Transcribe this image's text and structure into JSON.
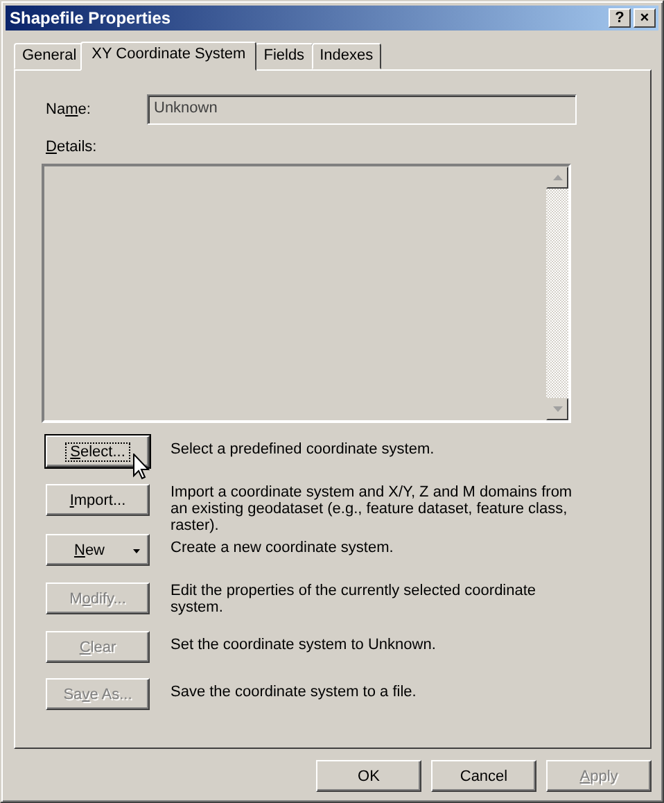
{
  "window": {
    "title": "Shapefile Properties",
    "title_buttons": [
      "?",
      "×"
    ]
  },
  "tabs": [
    {
      "label": "General",
      "selected": false
    },
    {
      "label": "XY Coordinate System",
      "selected": true
    },
    {
      "label": "Fields",
      "selected": false
    },
    {
      "label": "Indexes",
      "selected": false
    }
  ],
  "name_field": {
    "label": {
      "pre": "Na",
      "key": "m",
      "post": "e:"
    },
    "value": "Unknown"
  },
  "details": {
    "label": {
      "key": "D",
      "post": "etails:"
    }
  },
  "actions": [
    {
      "kind": "button",
      "label": {
        "key": "S",
        "post": "elect..."
      },
      "disabled": false,
      "focused": true,
      "description": "Select a predefined coordinate system."
    },
    {
      "kind": "button",
      "label": {
        "key": "I",
        "post": "mport..."
      },
      "disabled": false,
      "focused": false,
      "description": "Import a coordinate system and X/Y, Z and M domains from an existing geodataset (e.g., feature dataset, feature class, raster)."
    },
    {
      "kind": "dropdown",
      "label": {
        "key": "N",
        "post": "ew"
      },
      "disabled": false,
      "focused": false,
      "description": "Create a new coordinate system."
    },
    {
      "kind": "button",
      "label": {
        "pre": "M",
        "key": "o",
        "post": "dify..."
      },
      "disabled": true,
      "focused": false,
      "description": "Edit the properties of the currently selected coordinate system."
    },
    {
      "kind": "button",
      "label": {
        "key": "C",
        "post": "lear"
      },
      "disabled": true,
      "focused": false,
      "description": "Set the coordinate system to Unknown."
    },
    {
      "kind": "button",
      "label": {
        "pre": "Sa",
        "key": "v",
        "post": "e As..."
      },
      "disabled": true,
      "focused": false,
      "description": "Save the coordinate system to a file."
    }
  ],
  "buttons": [
    {
      "label": {
        "pre": "OK"
      },
      "disabled": false
    },
    {
      "label": {
        "pre": "Cancel"
      },
      "disabled": false
    },
    {
      "label": {
        "key": "A",
        "post": "pply"
      },
      "disabled": true
    }
  ]
}
